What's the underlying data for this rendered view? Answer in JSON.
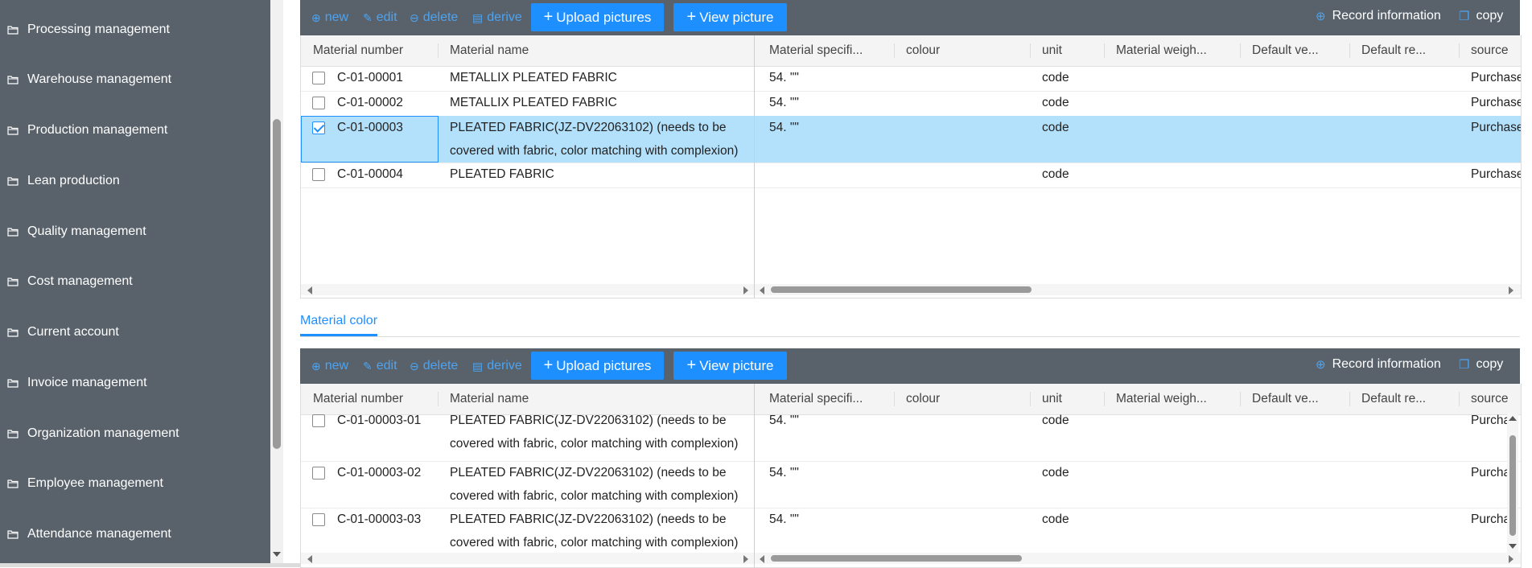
{
  "sidebar": {
    "items": [
      {
        "label": "Processing management"
      },
      {
        "label": "Warehouse management"
      },
      {
        "label": "Production management"
      },
      {
        "label": "Lean production"
      },
      {
        "label": "Quality management"
      },
      {
        "label": "Cost management"
      },
      {
        "label": "Current account"
      },
      {
        "label": "Invoice management"
      },
      {
        "label": "Organization management"
      },
      {
        "label": "Employee management"
      },
      {
        "label": "Attendance management"
      }
    ]
  },
  "toolbar": {
    "new_label": "new",
    "edit_label": "edit",
    "delete_label": "delete",
    "derive_label": "derive",
    "upload_label": "Upload pictures",
    "view_label": "View picture",
    "record_label": "Record information",
    "copy_label": "copy"
  },
  "columns": {
    "material_number": "Material number",
    "material_name": "Material name",
    "material_spec": "Material specifi...",
    "colour": "colour",
    "unit": "unit",
    "material_weight": "Material weigh...",
    "default_ve": "Default ve...",
    "default_re": "Default re...",
    "source": "source"
  },
  "materials": {
    "rows": [
      {
        "number": "C-01-00001",
        "name": "METALLIX PLEATED FABRIC",
        "spec": "54. \"\"",
        "unit": "code",
        "source": "Purchase",
        "checked": false
      },
      {
        "number": "C-01-00002",
        "name": "METALLIX PLEATED FABRIC",
        "spec": "54. \"\"",
        "unit": "code",
        "source": "Purchase",
        "checked": false
      },
      {
        "number": "C-01-00003",
        "name": "PLEATED FABRIC(JZ-DV22063102) (needs to be covered with fabric, color matching with complexion)",
        "spec": "54. \"\"",
        "unit": "code",
        "source": "Purchase",
        "checked": true
      },
      {
        "number": "C-01-00004",
        "name": "PLEATED FABRIC",
        "spec": "",
        "unit": "code",
        "source": "Purchase",
        "checked": false
      }
    ]
  },
  "tab": {
    "label": "Material color"
  },
  "colors": {
    "rows": [
      {
        "number": "C-01-00003-01",
        "name": "PLEATED FABRIC(JZ-DV22063102) (needs to be covered with fabric, color matching with complexion)",
        "spec": "54. \"\"",
        "unit": "code",
        "source": "Purchas"
      },
      {
        "number": "C-01-00003-02",
        "name": "PLEATED FABRIC(JZ-DV22063102) (needs to be covered with fabric, color matching with complexion)",
        "spec": "54. \"\"",
        "unit": "code",
        "source": "Purchas"
      },
      {
        "number": "C-01-00003-03",
        "name": "PLEATED FABRIC(JZ-DV22063102) (needs to be covered with fabric, color matching with complexion)",
        "spec": "54. \"\"",
        "unit": "code",
        "source": "Purchas"
      }
    ]
  },
  "accent": "#1e8fff",
  "panel_bg": "#59626b",
  "selected_row_bg": "#b3e1fb"
}
